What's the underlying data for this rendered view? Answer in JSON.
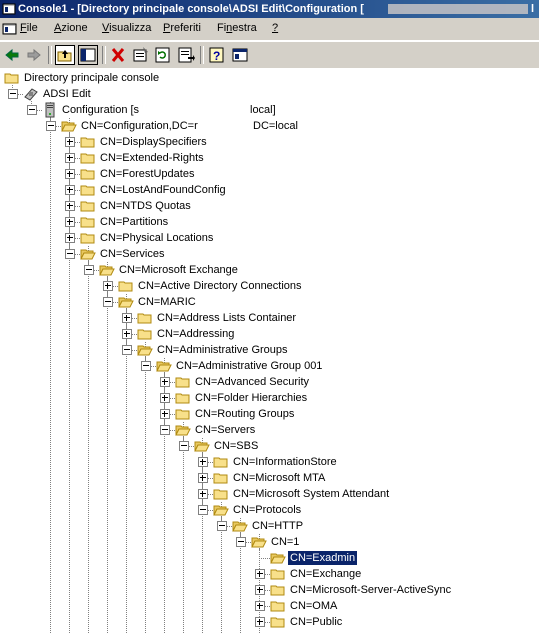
{
  "window": {
    "title": "Console1 - [Directory principale console\\ADSI Edit\\Configuration [",
    "title_suffix": "l"
  },
  "menu": [
    "File",
    "Azione",
    "Visualizza",
    "Preferiti",
    "Finestra",
    "?"
  ],
  "menu_underline": [
    "F",
    "A",
    "V",
    "P",
    "n",
    "?"
  ],
  "toolbar_icons": [
    "back-arrow-icon",
    "forward-arrow-icon",
    "up-folder-icon",
    "show-hide-tree-icon",
    "delete-icon",
    "properties-icon",
    "refresh-icon",
    "export-list-icon",
    "help-icon",
    "console-icon"
  ],
  "tree": [
    {
      "label": "Directory principale console",
      "depth": 0,
      "icon": "folder",
      "expander": "none"
    },
    {
      "label": "ADSI Edit",
      "depth": 1,
      "icon": "adsi",
      "expander": "minus"
    },
    {
      "label": "Configuration [s",
      "label_tail": "local]",
      "depth": 2,
      "icon": "server",
      "expander": "minus"
    },
    {
      "label": "CN=Configuration,DC=r",
      "label_tail": "DC=local",
      "depth": 3,
      "icon": "folder-open",
      "expander": "minus"
    },
    {
      "label": "CN=DisplaySpecifiers",
      "depth": 4,
      "icon": "folder",
      "expander": "plus"
    },
    {
      "label": "CN=Extended-Rights",
      "depth": 4,
      "icon": "folder",
      "expander": "plus"
    },
    {
      "label": "CN=ForestUpdates",
      "depth": 4,
      "icon": "folder",
      "expander": "plus"
    },
    {
      "label": "CN=LostAndFoundConfig",
      "depth": 4,
      "icon": "folder",
      "expander": "plus"
    },
    {
      "label": "CN=NTDS Quotas",
      "depth": 4,
      "icon": "folder",
      "expander": "plus"
    },
    {
      "label": "CN=Partitions",
      "depth": 4,
      "icon": "folder",
      "expander": "plus"
    },
    {
      "label": "CN=Physical Locations",
      "depth": 4,
      "icon": "folder",
      "expander": "plus"
    },
    {
      "label": "CN=Services",
      "depth": 4,
      "icon": "folder-open",
      "expander": "minus"
    },
    {
      "label": "CN=Microsoft Exchange",
      "depth": 5,
      "icon": "folder-open",
      "expander": "minus"
    },
    {
      "label": "CN=Active Directory Connections",
      "depth": 6,
      "icon": "folder",
      "expander": "plus"
    },
    {
      "label": "CN=MARIC",
      "depth": 6,
      "icon": "folder-open",
      "expander": "minus"
    },
    {
      "label": "CN=Address Lists Container",
      "depth": 7,
      "icon": "folder",
      "expander": "plus"
    },
    {
      "label": "CN=Addressing",
      "depth": 7,
      "icon": "folder",
      "expander": "plus"
    },
    {
      "label": "CN=Administrative Groups",
      "depth": 7,
      "icon": "folder-open",
      "expander": "minus"
    },
    {
      "label": "CN=Administrative Group 001",
      "depth": 8,
      "icon": "folder-open",
      "expander": "minus"
    },
    {
      "label": "CN=Advanced Security",
      "depth": 9,
      "icon": "folder",
      "expander": "plus"
    },
    {
      "label": "CN=Folder Hierarchies",
      "depth": 9,
      "icon": "folder",
      "expander": "plus"
    },
    {
      "label": "CN=Routing Groups",
      "depth": 9,
      "icon": "folder",
      "expander": "plus"
    },
    {
      "label": "CN=Servers",
      "depth": 9,
      "icon": "folder-open",
      "expander": "minus"
    },
    {
      "label": "CN=SBS",
      "depth": 10,
      "icon": "folder-open",
      "expander": "minus"
    },
    {
      "label": "CN=InformationStore",
      "depth": 11,
      "icon": "folder",
      "expander": "plus"
    },
    {
      "label": "CN=Microsoft MTA",
      "depth": 11,
      "icon": "folder",
      "expander": "plus"
    },
    {
      "label": "CN=Microsoft System Attendant",
      "depth": 11,
      "icon": "folder",
      "expander": "plus"
    },
    {
      "label": "CN=Protocols",
      "depth": 11,
      "icon": "folder-open",
      "expander": "minus"
    },
    {
      "label": "CN=HTTP",
      "depth": 12,
      "icon": "folder-open",
      "expander": "minus"
    },
    {
      "label": "CN=1",
      "depth": 13,
      "icon": "folder-open",
      "expander": "minus"
    },
    {
      "label": "CN=Exadmin",
      "depth": 14,
      "icon": "folder-open",
      "expander": "none",
      "selected": true
    },
    {
      "label": "CN=Exchange",
      "depth": 14,
      "icon": "folder",
      "expander": "plus"
    },
    {
      "label": "CN=Microsoft-Server-ActiveSync",
      "depth": 14,
      "icon": "folder",
      "expander": "plus"
    },
    {
      "label": "CN=OMA",
      "depth": 14,
      "icon": "folder",
      "expander": "plus"
    },
    {
      "label": "CN=Public",
      "depth": 14,
      "icon": "folder",
      "expander": "plus"
    }
  ],
  "colors": {
    "titlebar_start": "#0a246a",
    "titlebar_end": "#3a6ea5",
    "chrome": "#d4d0c8",
    "selection": "#0a246a",
    "folder_fill": "#f8e08a",
    "folder_edge": "#b08a10"
  }
}
